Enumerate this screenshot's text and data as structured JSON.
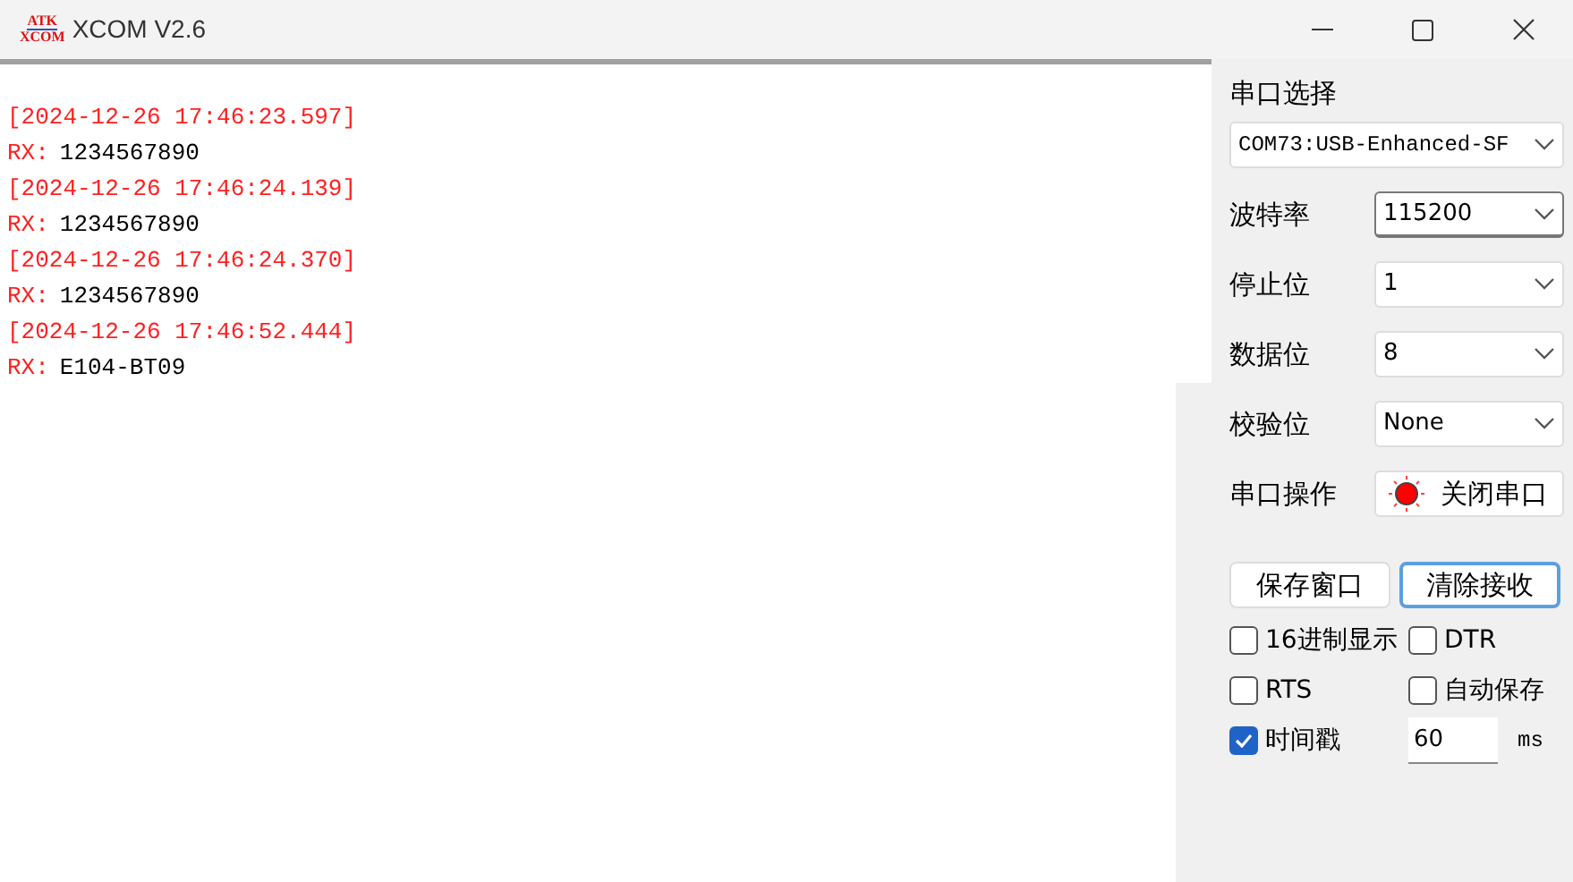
{
  "window": {
    "title": "XCOM V2.6",
    "logo": [
      "ATK",
      "XCOM"
    ]
  },
  "log": [
    {
      "kind": "time",
      "text": "[2024-12-26 17:46:23.597]"
    },
    {
      "kind": "rx",
      "prefix": "RX:",
      "text": "1234567890"
    },
    {
      "kind": "time",
      "text": "[2024-12-26 17:46:24.139]"
    },
    {
      "kind": "rx",
      "prefix": "RX:",
      "text": "1234567890"
    },
    {
      "kind": "time",
      "text": "[2024-12-26 17:46:24.370]"
    },
    {
      "kind": "rx",
      "prefix": "RX:",
      "text": "1234567890"
    },
    {
      "kind": "time",
      "text": "[2024-12-26 17:46:52.444]"
    },
    {
      "kind": "rx",
      "prefix": "RX:",
      "text": "E104-BT09"
    }
  ],
  "port": {
    "label": "串口选择",
    "value": "COM73:USB-Enhanced-SF"
  },
  "settings": [
    {
      "label": "波特率",
      "value": "115200",
      "focused": true
    },
    {
      "label": "停止位",
      "value": "1",
      "focused": false
    },
    {
      "label": "数据位",
      "value": "8",
      "focused": false
    },
    {
      "label": "校验位",
      "value": "None",
      "focused": false
    }
  ],
  "port_op": {
    "label": "串口操作",
    "button": "关闭串口",
    "open": true
  },
  "buttons": [
    {
      "label": "保存窗口",
      "focused": false
    },
    {
      "label": "清除接收",
      "focused": true
    }
  ],
  "options": [
    {
      "label": "16进制显示",
      "checked": false
    },
    {
      "label": "DTR",
      "checked": false
    },
    {
      "label": "RTS",
      "checked": false
    },
    {
      "label": "自动保存",
      "checked": false
    },
    {
      "label": "时间戳",
      "checked": true
    }
  ],
  "interval": {
    "value": "60",
    "unit": "ms"
  }
}
